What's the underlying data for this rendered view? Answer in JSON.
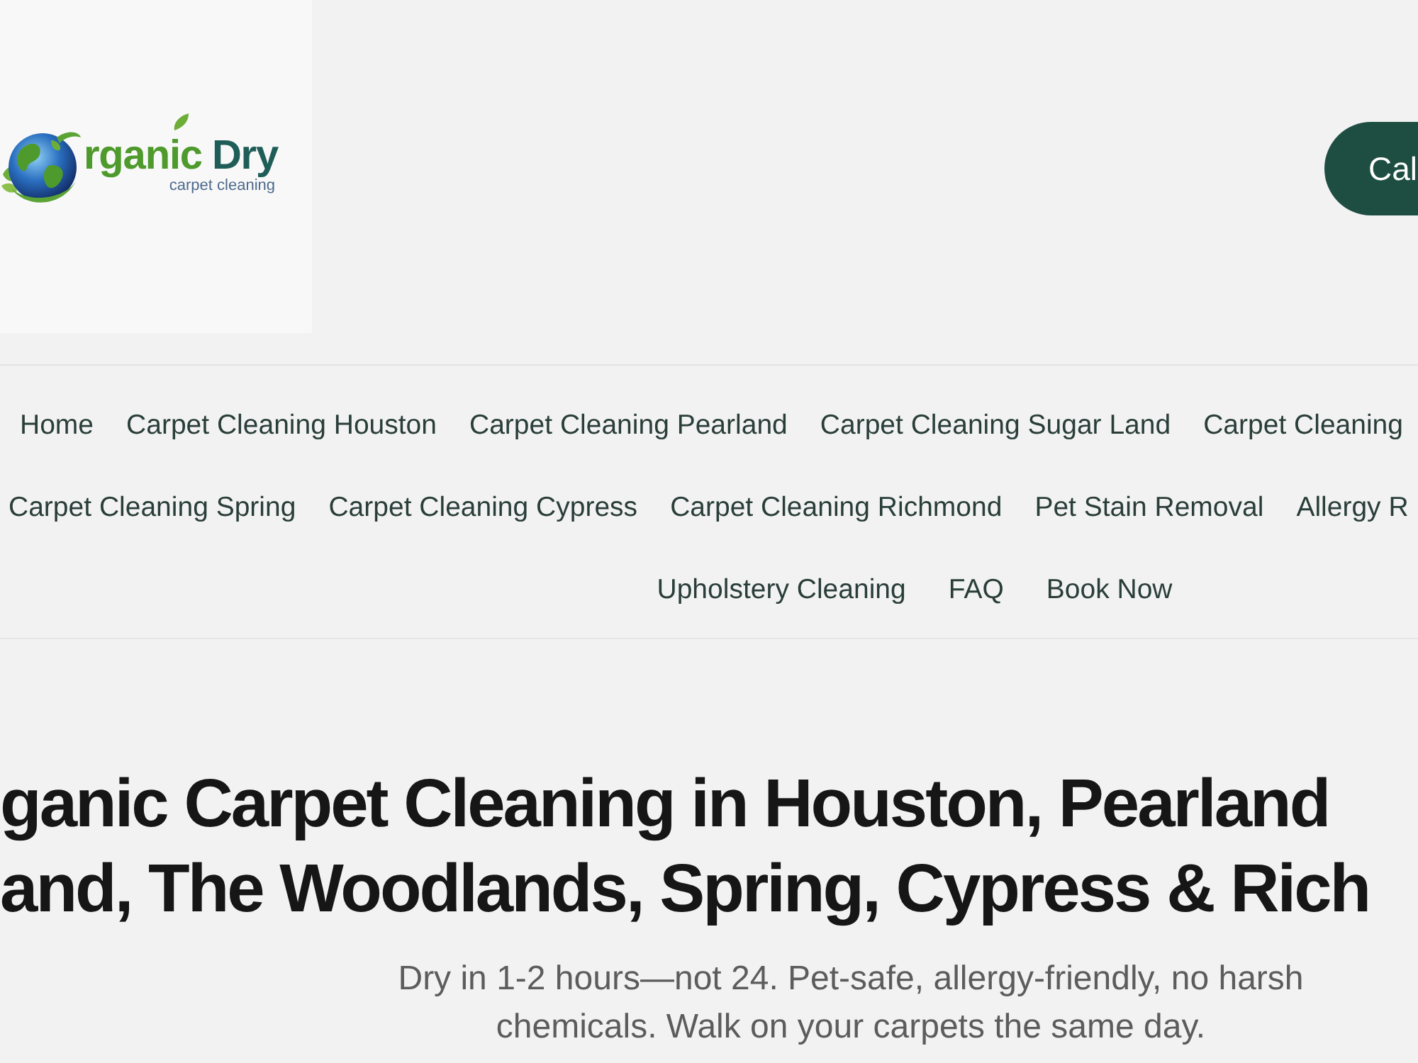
{
  "header": {
    "logo": {
      "wordmark": "rganic",
      "accent": "Dry",
      "tagline": "carpet cleaning"
    },
    "call_button": {
      "label": "Cal"
    }
  },
  "nav": {
    "lines": [
      {
        "links": [
          "Home",
          "Carpet Cleaning Houston",
          "Carpet Cleaning Pearland",
          "Carpet Cleaning Sugar Land",
          "Carpet Cleaning"
        ]
      },
      {
        "links": [
          "Carpet Cleaning Spring",
          "Carpet Cleaning Cypress",
          "Carpet Cleaning Richmond",
          "Pet Stain Removal",
          "Allergy R"
        ]
      },
      {
        "links": [
          "Upholstery Cleaning",
          "FAQ",
          "Book Now"
        ]
      }
    ]
  },
  "hero": {
    "heading_lines": [
      "ganic Carpet Cleaning in Houston, Pearland",
      "and, The Woodlands, Spring, Cypress & Rich"
    ],
    "intro": "Dry in 1-2 hours—not 24. Pet-safe, allergy-friendly, no harsh chemicals. Walk on your carpets the same day."
  }
}
